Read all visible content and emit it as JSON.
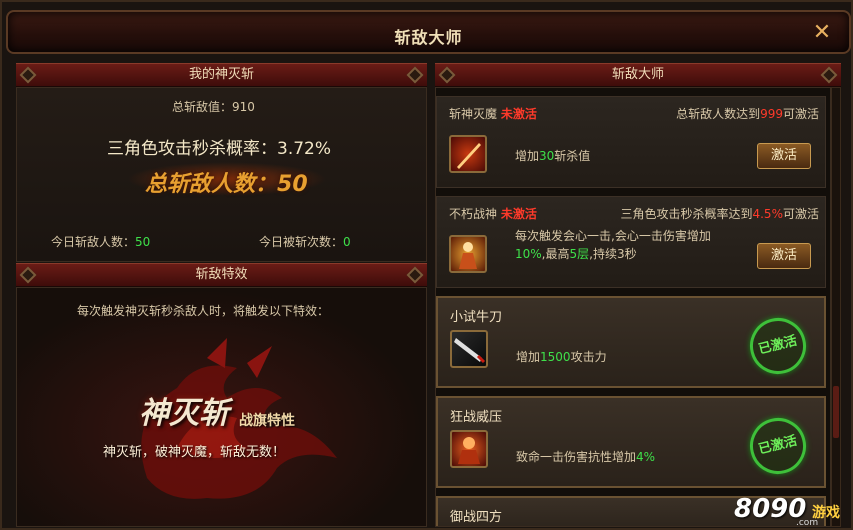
{
  "window": {
    "title": "斩敌大师",
    "close_label": "✕"
  },
  "left": {
    "header": "我的神灭斩",
    "total_value_label": "总斩敌值：",
    "total_value": "910",
    "kill_rate_label": "三角色攻击秒杀概率：",
    "kill_rate": "3.72%",
    "total_kills_label": "总斩敌人数：",
    "total_kills": "50",
    "today_kills_label": "今日斩敌人数：",
    "today_kills": "50",
    "today_killed_label": "今日被斩次数：",
    "today_killed": "0"
  },
  "effects": {
    "header": "斩敌特效",
    "desc": "每次触发神灭斩秒杀敌人时，将触发以下特效：",
    "art_title": "神灭斩",
    "art_subtitle": "战旗特性",
    "quote": "神灭斩，破神灭魔，斩敌无数！"
  },
  "master": {
    "header": "斩敌大师",
    "cards": [
      {
        "name": "斩神灭魔",
        "status": "未激活",
        "cond_prefix": "总斩敌人数达到",
        "cond_value": "999",
        "cond_suffix": "可激活",
        "desc_prefix": "增加",
        "desc_value": "30",
        "desc_suffix": "斩杀值",
        "button": "激活"
      },
      {
        "name": "不朽战神",
        "status": "未激活",
        "cond_prefix": "三角色攻击秒杀概率达到",
        "cond_value": "4.5%",
        "cond_suffix": "可激活",
        "desc_line1": "每次触发会心一击,会心一击伤害增加",
        "desc_v1": "10%",
        "desc_mid": ",最高",
        "desc_v2": "5层",
        "desc_end": ",持续3秒",
        "button": "激活"
      },
      {
        "name": "小试牛刀",
        "desc_prefix": "增加",
        "desc_value": "1500",
        "desc_suffix": "攻击力",
        "stamp": "已激活"
      },
      {
        "name": "狂战威压",
        "desc_prefix": "致命一击伤害抗性增加",
        "desc_value": "4%",
        "stamp": "已激活"
      },
      {
        "name": "御战四方"
      }
    ]
  },
  "watermark": {
    "digits": "8090",
    "text": "游戏",
    "domain": ".com"
  }
}
